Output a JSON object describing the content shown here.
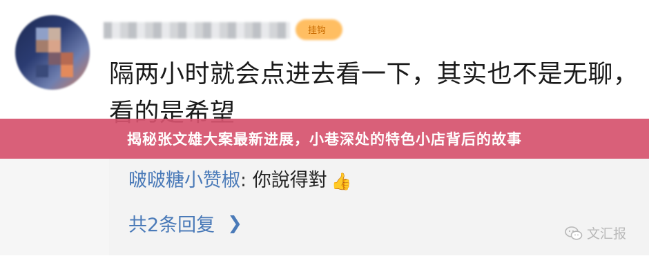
{
  "comment": {
    "username_blurred": "",
    "badge_label": "挂钩",
    "text": "隔两小时就会点进去看一下，其实也不是无聊，看的是希望"
  },
  "banner": {
    "title": "揭秘张文雄大案最新进展，小巷深处的特色小店背后的故事"
  },
  "reply": {
    "user": "啵啵糖小赞椒",
    "separator": ":",
    "content": "你說得對",
    "thumb_icon": "thumbs-up-icon"
  },
  "more_replies": {
    "label": "共2条回复",
    "icon": "chevron-right-icon"
  },
  "watermark": {
    "icon": "wechat-icon",
    "text": "文汇报"
  },
  "colors": {
    "banner": "#d6536e",
    "link_blue": "#4a7ab8",
    "text_dark": "#1b1b1b"
  }
}
